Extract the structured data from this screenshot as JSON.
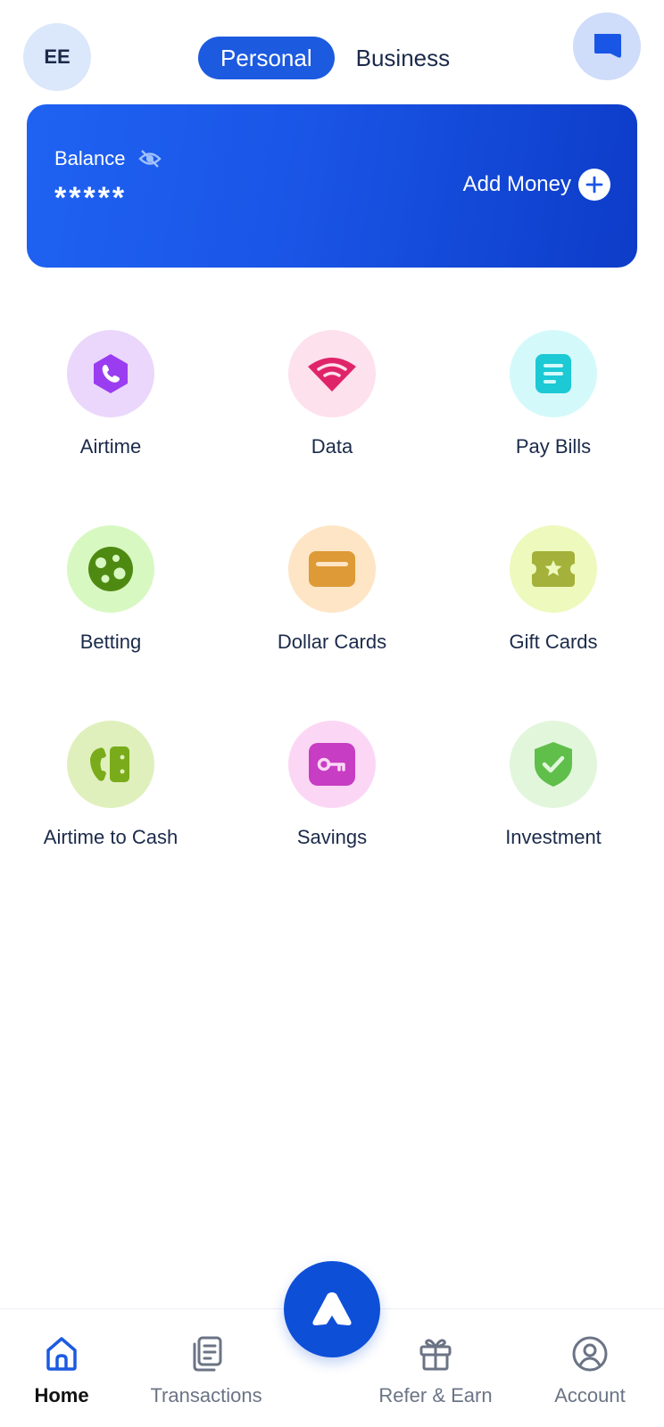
{
  "header": {
    "avatar_initials": "EE",
    "tabs": [
      {
        "label": "Personal",
        "active": true
      },
      {
        "label": "Business",
        "active": false
      }
    ]
  },
  "balance_card": {
    "label": "Balance",
    "value": "*****",
    "add_money_label": "Add Money"
  },
  "services": [
    {
      "label": "Airtime",
      "icon": "phone-icon",
      "bg": "#ead7fb",
      "fg": "#9a3df0"
    },
    {
      "label": "Data",
      "icon": "wifi-icon",
      "bg": "#fde1ec",
      "fg": "#e0246a"
    },
    {
      "label": "Pay Bills",
      "icon": "bill-icon",
      "bg": "#d4f9fb",
      "fg": "#1cc9d4"
    },
    {
      "label": "Betting",
      "icon": "ball-icon",
      "bg": "#d8f8c2",
      "fg": "#4e8a12"
    },
    {
      "label": "Dollar Cards",
      "icon": "card-icon",
      "bg": "#fde5c6",
      "fg": "#dd9a36"
    },
    {
      "label": "Gift Cards",
      "icon": "gift-card-icon",
      "bg": "#eef9bd",
      "fg": "#a4b13a"
    },
    {
      "label": "Airtime to Cash",
      "icon": "airtime-cash-icon",
      "bg": "#dff0bd",
      "fg": "#79ab1a"
    },
    {
      "label": "Savings",
      "icon": "key-icon",
      "bg": "#fbd7f5",
      "fg": "#c73dc3"
    },
    {
      "label": "Investment",
      "icon": "shield-check-icon",
      "bg": "#e2f6dc",
      "fg": "#5fbf4a"
    }
  ],
  "bottom_nav": {
    "items": [
      {
        "label": "Home",
        "icon": "home-icon",
        "active": true
      },
      {
        "label": "Transactions",
        "icon": "transactions-icon",
        "active": false
      },
      {
        "label": "Refer & Earn",
        "icon": "gift-icon",
        "active": false
      },
      {
        "label": "Account",
        "icon": "account-icon",
        "active": false
      }
    ],
    "center_action_icon": "logo-icon"
  },
  "colors": {
    "primary": "#1c5ae0",
    "nav_active": "#1c5ae0",
    "nav_inactive": "#6b7485"
  }
}
